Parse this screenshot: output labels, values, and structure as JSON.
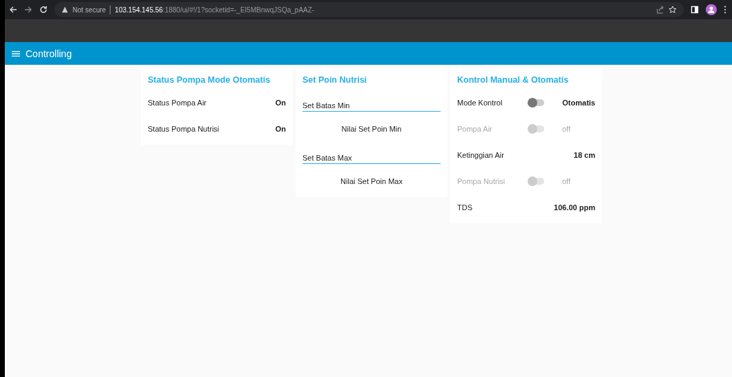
{
  "browser": {
    "security": "Not secure",
    "url_host": "103.154.145.56",
    "url_rest": ":1880/ui/#!/1?socketid=-_EI5MBnwqJSQa_pAAZ-"
  },
  "header": {
    "title": "Controlling"
  },
  "cards": [
    {
      "title": "Status Pompa Mode Otomatis",
      "items": [
        {
          "kind": "text",
          "label": "Status Pompa Air",
          "value": "On"
        },
        {
          "kind": "text",
          "label": "Status Pompa Nutrisi",
          "value": "On"
        }
      ]
    },
    {
      "title": "Set Poin Nutrisi",
      "items": [
        {
          "kind": "input",
          "placeholder": "Set Batas Min"
        },
        {
          "kind": "note",
          "label": "Nilai Set Poin Min"
        },
        {
          "kind": "input",
          "placeholder": "Set Batas Max"
        },
        {
          "kind": "note",
          "label": "Nilai Set Poin Max"
        }
      ]
    },
    {
      "title": "Kontrol Manual & Otomatis",
      "items": [
        {
          "kind": "switch",
          "label": "Mode Kontrol",
          "on": false,
          "disabled": false,
          "value": "Otomatis"
        },
        {
          "kind": "switch",
          "label": "Pompa Air",
          "on": false,
          "disabled": true,
          "value": "off"
        },
        {
          "kind": "text",
          "label": "Ketinggian Air",
          "value": "18 cm"
        },
        {
          "kind": "switch",
          "label": "Pompa Nutrisi",
          "on": false,
          "disabled": true,
          "value": "off"
        },
        {
          "kind": "text",
          "label": "TDS",
          "value": "106.00 ppm"
        }
      ]
    }
  ]
}
